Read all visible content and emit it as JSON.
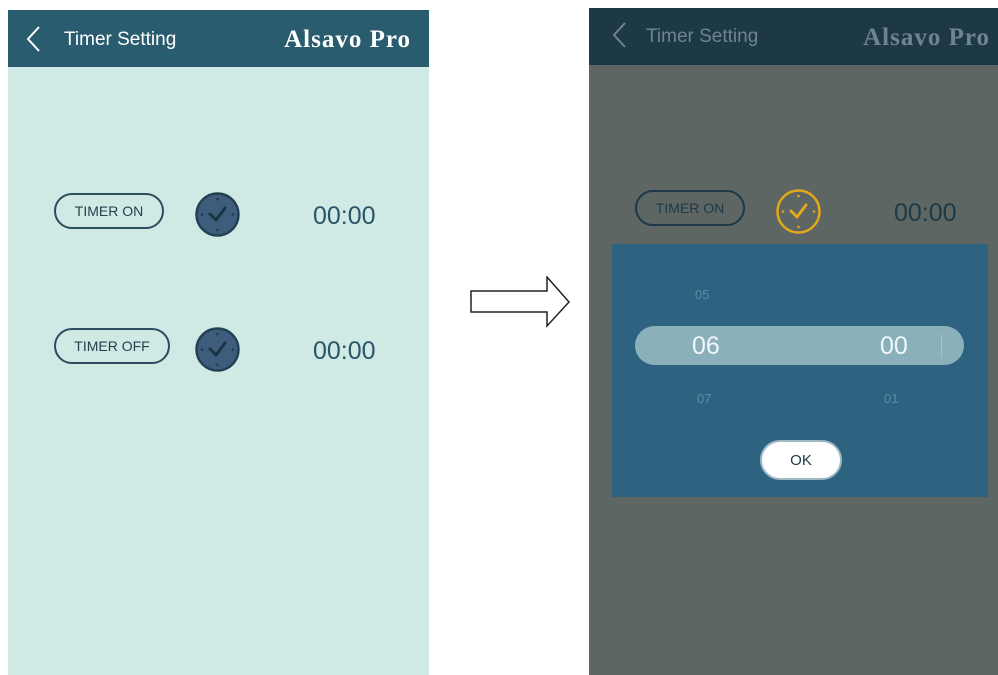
{
  "left_screen": {
    "header": {
      "title": "Timer Setting",
      "brand": "Alsavo Pro"
    },
    "timer_on": {
      "label": "TIMER ON",
      "time": "00:00"
    },
    "timer_off": {
      "label": "TIMER OFF",
      "time": "00:00"
    }
  },
  "right_screen": {
    "header": {
      "title": "Timer Setting",
      "brand": "Alsavo Pro"
    },
    "timer_on": {
      "label": "TIMER ON",
      "time": "00:00"
    },
    "picker": {
      "hour_prev": "05",
      "hour_selected": "06",
      "hour_next": "07",
      "minute_selected": "00",
      "minute_next": "01"
    },
    "ok_label": "OK"
  },
  "colors": {
    "header_bg": "#2a5c6f",
    "screen_bg": "#cfe9e4",
    "clock_active": "#e1a81b",
    "dialog_bg": "#2d6280"
  }
}
